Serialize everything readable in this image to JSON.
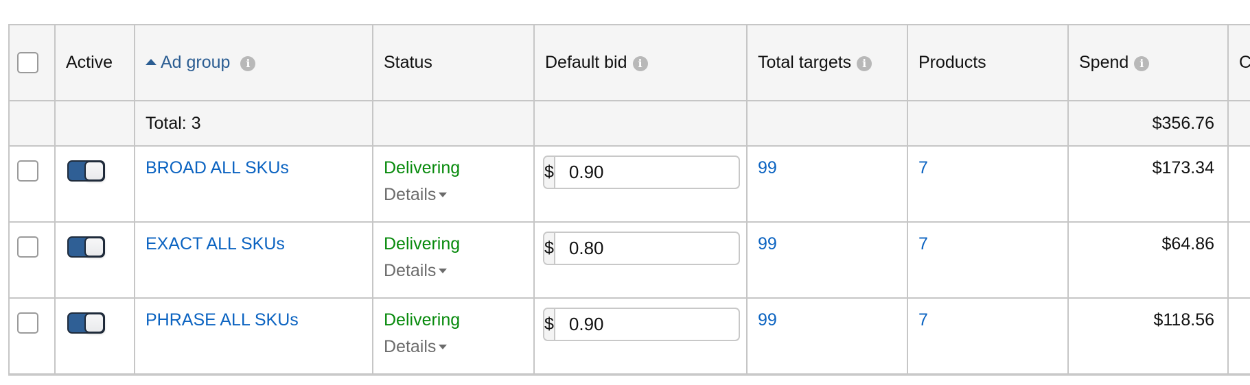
{
  "table": {
    "columns": [
      {
        "key": "select",
        "label": ""
      },
      {
        "key": "active",
        "label": "Active"
      },
      {
        "key": "ad_group",
        "label": "Ad group",
        "sorted": "ascending",
        "info_icon": "info-icon"
      },
      {
        "key": "status",
        "label": "Status"
      },
      {
        "key": "default_bid",
        "label": "Default bid",
        "info_icon": "info-icon"
      },
      {
        "key": "total_targets",
        "label": "Total targets",
        "info_icon": "info-icon"
      },
      {
        "key": "products",
        "label": "Products"
      },
      {
        "key": "spend",
        "label": "Spend",
        "info_icon": "info-icon"
      },
      {
        "key": "next",
        "label": "C"
      }
    ],
    "total_row": {
      "label": "Total: 3",
      "spend": "$356.76"
    },
    "rows": [
      {
        "selected": false,
        "active": true,
        "ad_group": "BROAD ALL SKUs",
        "status": "Delivering",
        "details_label": "Details",
        "bid_currency": "$",
        "default_bid": "0.90",
        "total_targets": "99",
        "products": "7",
        "spend": "$173.34"
      },
      {
        "selected": false,
        "active": true,
        "ad_group": "EXACT ALL SKUs",
        "status": "Delivering",
        "details_label": "Details",
        "bid_currency": "$",
        "default_bid": "0.80",
        "total_targets": "99",
        "products": "7",
        "spend": "$64.86"
      },
      {
        "selected": false,
        "active": true,
        "ad_group": "PHRASE ALL SKUs",
        "status": "Delivering",
        "details_label": "Details",
        "bid_currency": "$",
        "default_bid": "0.90",
        "total_targets": "99",
        "products": "7",
        "spend": "$118.56"
      }
    ]
  },
  "colors": {
    "link": "#0b63c1",
    "sort_header": "#2b5d92",
    "status_delivering": "#078a0c",
    "toggle_on": "#2f5f95",
    "header_bg": "#f5f5f5",
    "border": "#c6c6c6"
  }
}
